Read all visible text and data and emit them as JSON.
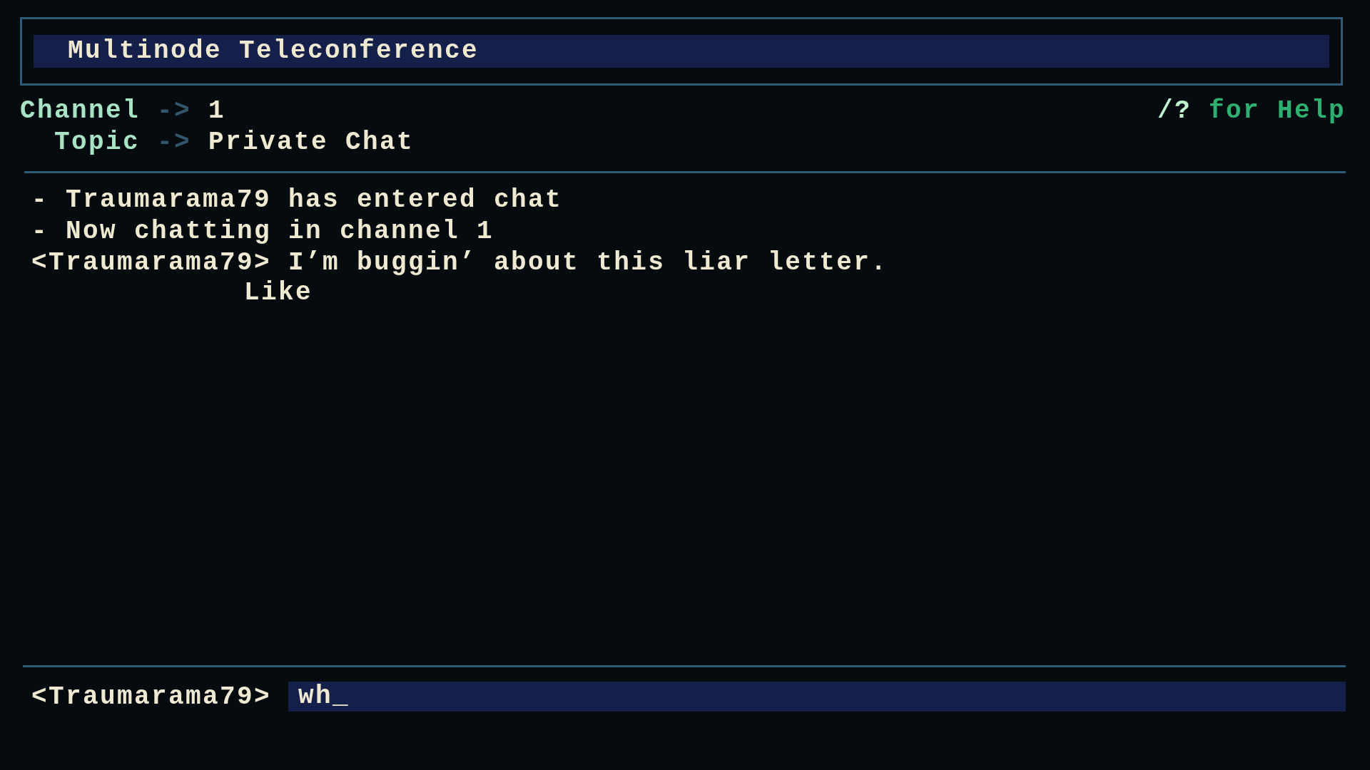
{
  "window": {
    "title": "Multinode Teleconference"
  },
  "header": {
    "fields": [
      {
        "label": "Channel",
        "arrow": "->",
        "value": "1"
      },
      {
        "label": "  Topic",
        "arrow": "->",
        "value": "Private Chat"
      }
    ],
    "help": {
      "key": "/?",
      "text": "for Help"
    }
  },
  "messages": [
    {
      "kind": "system",
      "text": "- Traumarama79 has entered chat"
    },
    {
      "kind": "system",
      "text": "- Now chatting in channel 1"
    },
    {
      "kind": "chat",
      "speaker": "<Traumarama79>",
      "lines": [
        "I’m buggin’ about this liar letter.",
        "Like"
      ]
    }
  ],
  "input": {
    "prompt": "<Traumarama79>",
    "value": "wh_"
  }
}
